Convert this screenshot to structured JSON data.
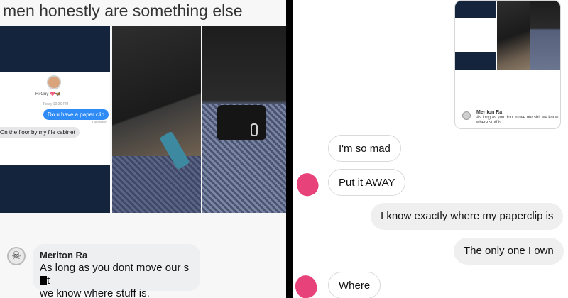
{
  "left_panel": {
    "caption": "men honestly are something else",
    "screenshot": {
      "contact_name": "Ri Guy 💖🦋",
      "timestamp": "Today 10:26 PM",
      "sent_message": "Do u have a paper clip",
      "delivered_label": "Delivered",
      "received_message": "On the floor by my file cabinet"
    },
    "comment": {
      "author": "Meriton Ra",
      "text_line1_pre": "As long as you dont move our s",
      "text_line1_post": "t",
      "text_line2": "we know where stuff is."
    }
  },
  "right_panel": {
    "preview": {
      "author": "Meriton Ra",
      "text": "As long as you dont move our shit we know where stuff is."
    },
    "messages": [
      {
        "text": "I'm so mad",
        "side": "received"
      },
      {
        "text": "Put it AWAY",
        "side": "received"
      },
      {
        "text": "I know exactly where my paperclip is",
        "side": "sent"
      },
      {
        "text": "The only one I own",
        "side": "sent"
      },
      {
        "text": "Where",
        "side": "received"
      }
    ]
  },
  "colors": {
    "sent_bubble_blue": "#2f8cf7",
    "heart_pink": "#e8427a",
    "navy_bg": "#14243d"
  }
}
